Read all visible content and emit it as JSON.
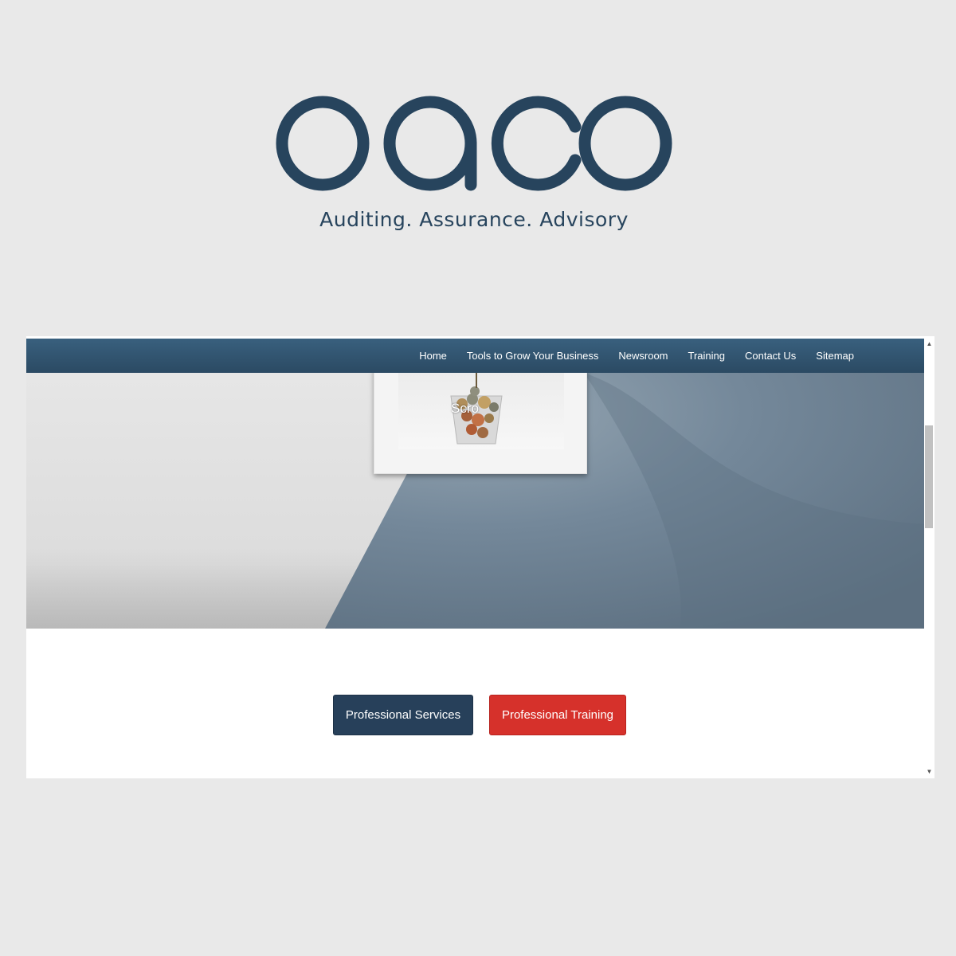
{
  "brand": {
    "logo_text": "oaco",
    "tagline": "Auditing. Assurance. Advisory",
    "color": "#27445d"
  },
  "nav": {
    "items": [
      {
        "label": "Home"
      },
      {
        "label": "Tools to Grow Your Business"
      },
      {
        "label": "Newsroom"
      },
      {
        "label": "Training"
      },
      {
        "label": "Contact Us"
      },
      {
        "label": "Sitemap"
      }
    ],
    "background": "#2f5070"
  },
  "hero": {
    "overlay_text": "Scro"
  },
  "buttons": {
    "services_label": "Professional Services",
    "training_label": "Professional Training",
    "services_color": "#27405a",
    "training_color": "#d6312b"
  },
  "scrollbar": {
    "up_icon": "scroll-up-arrow",
    "down_icon": "scroll-down-arrow"
  }
}
